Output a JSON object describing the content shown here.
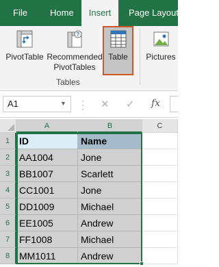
{
  "ribbon_tabs": {
    "file": "File",
    "home": "Home",
    "insert": "Insert",
    "page_layout": "Page Layout"
  },
  "ribbon": {
    "pivot_table": "PivotTable",
    "recommended_line1": "Recommended",
    "recommended_line2": "PivotTables",
    "table": "Table",
    "pictures": "Pictures",
    "group_label": "Tables"
  },
  "formula_bar": {
    "name_box": "A1",
    "fx": "fx"
  },
  "grid": {
    "columns": [
      "A",
      "B",
      "C"
    ],
    "rows": [
      {
        "num": "1",
        "a": "ID",
        "b": "Name"
      },
      {
        "num": "2",
        "a": "AA1004",
        "b": "Jone"
      },
      {
        "num": "3",
        "a": "BB1007",
        "b": "Scarlett"
      },
      {
        "num": "4",
        "a": "CC1001",
        "b": "Jone"
      },
      {
        "num": "5",
        "a": "DD1009",
        "b": "Michael"
      },
      {
        "num": "6",
        "a": "EE1005",
        "b": "Andrew"
      },
      {
        "num": "7",
        "a": "FF1008",
        "b": "Michael"
      },
      {
        "num": "8",
        "a": "MM1011",
        "b": "Andrew"
      }
    ]
  },
  "colors": {
    "excel_green": "#217346",
    "highlight_outline": "#d2552a",
    "header_a": "#dbeef7",
    "header_b": "#a6bccb",
    "selection_fill": "#d0d0d0"
  }
}
